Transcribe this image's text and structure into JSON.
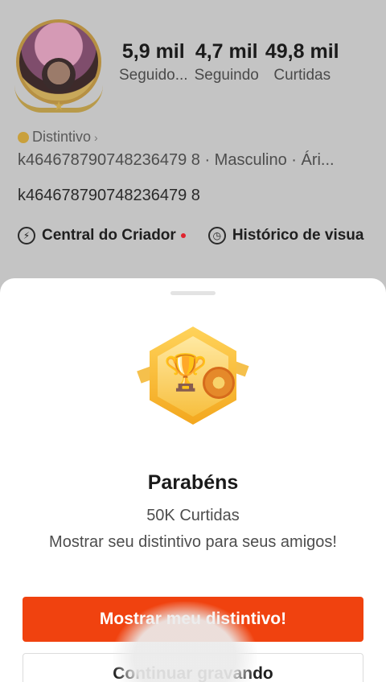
{
  "profile": {
    "stats": [
      {
        "value": "5,9 mil",
        "label": "Seguido..."
      },
      {
        "value": "4,7 mil",
        "label": "Seguindo"
      },
      {
        "value": "49,8 mil",
        "label": "Curtidas"
      }
    ],
    "badge_label": "Distintivo",
    "meta_line": "k464678790748236479 8 · Masculino · Ári...",
    "user_id": "k464678790748236479 8",
    "actions": [
      {
        "label": "Central do Criador",
        "icon": "lightning-icon"
      },
      {
        "label": "Histórico de visua",
        "icon": "clock-icon"
      }
    ]
  },
  "sheet": {
    "title": "Parabéns",
    "subtitle": "50K Curtidas",
    "description": "Mostrar seu distintivo para seus amigos!",
    "primary_button": "Mostrar meu distintivo!",
    "secondary_button": "Continuar gravando"
  },
  "colors": {
    "accent": "#f0420f",
    "badge_gold": "#f3a71e"
  }
}
